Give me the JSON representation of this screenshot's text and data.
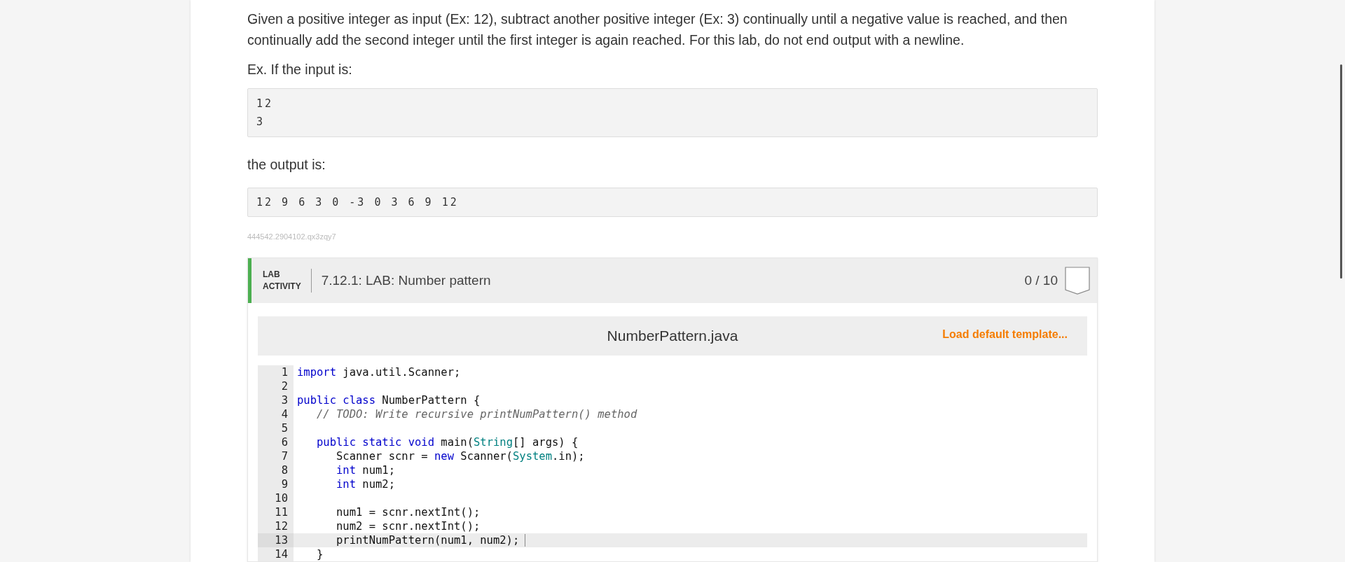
{
  "problem": {
    "paragraphs": [
      "Given a positive integer as input (Ex: 12), subtract another positive integer (Ex: 3) continually until a negative value is reached, and then continually add the second integer until the first integer is again reached. For this lab, do not end output with a newline.",
      "Ex. If the input is:"
    ],
    "input_lines": [
      "12",
      "3"
    ],
    "output_label": "the output is:",
    "output_lines": [
      "12 9 6 3 0 -3 0 3 6 9 12"
    ],
    "reference_id": "444542.2904102.qx3zqy7"
  },
  "lab": {
    "tag_lines": [
      "LAB",
      "ACTIVITY"
    ],
    "title": "7.12.1: LAB: Number pattern",
    "score": "0 / 10",
    "editor": {
      "filename": "NumberPattern.java",
      "action": "Load default template...",
      "lines": [
        {
          "number": "1",
          "selected": false,
          "tokens": [
            {
              "text": "import",
              "kind": "keyword"
            },
            {
              "text": " java.util.Scanner;",
              "kind": "plain"
            }
          ]
        },
        {
          "number": "2",
          "selected": false
        },
        {
          "number": "3",
          "selected": false,
          "tokens": [
            {
              "text": "public class",
              "kind": "keyword"
            },
            {
              "text": " NumberPattern {",
              "kind": "plain"
            }
          ]
        },
        {
          "number": "4",
          "selected": false,
          "tokens": [
            {
              "text": "   // TODO: Write recursive printNumPattern() method",
              "kind": "comment"
            }
          ]
        },
        {
          "number": "5",
          "selected": false
        },
        {
          "number": "6",
          "selected": false,
          "tokens": [
            {
              "text": "   public static void",
              "kind": "keyword"
            },
            {
              "text": " main(",
              "kind": "plain"
            },
            {
              "text": "String",
              "kind": "type"
            },
            {
              "text": "[] args) {",
              "kind": "plain"
            }
          ]
        },
        {
          "number": "7",
          "selected": false,
          "tokens": [
            {
              "text": "      Scanner scnr = ",
              "kind": "plain"
            },
            {
              "text": "new",
              "kind": "keyword"
            },
            {
              "text": " Scanner(",
              "kind": "plain"
            },
            {
              "text": "System",
              "kind": "type"
            },
            {
              "text": ".in);",
              "kind": "plain"
            }
          ]
        },
        {
          "number": "8",
          "selected": false,
          "tokens": [
            {
              "text": "      int",
              "kind": "keyword"
            },
            {
              "text": " num1;",
              "kind": "plain"
            }
          ]
        },
        {
          "number": "9",
          "selected": false,
          "tokens": [
            {
              "text": "      int",
              "kind": "keyword"
            },
            {
              "text": " num2;",
              "kind": "plain"
            }
          ]
        },
        {
          "number": "10",
          "selected": false
        },
        {
          "number": "11",
          "selected": false,
          "tokens": [
            {
              "text": "      num1 = scnr.nextInt();",
              "kind": "plain"
            }
          ]
        },
        {
          "number": "12",
          "selected": false,
          "tokens": [
            {
              "text": "      num2 = scnr.nextInt();",
              "kind": "plain"
            }
          ]
        },
        {
          "number": "13",
          "selected": true,
          "tokens": [
            {
              "text": "      printNumPattern(num1, num2);",
              "kind": "plain"
            }
          ]
        },
        {
          "number": "14",
          "selected": false,
          "tokens": [
            {
              "text": "   }",
              "kind": "plain"
            }
          ]
        }
      ]
    }
  }
}
